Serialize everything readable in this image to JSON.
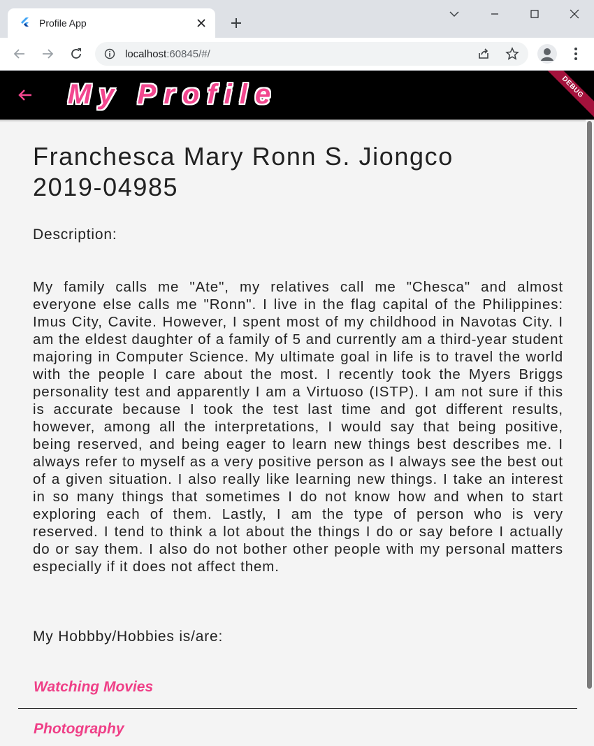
{
  "browser": {
    "tab_title": "Profile App",
    "url_host": "localhost",
    "url_rest": ":60845/#/",
    "icons": [
      "flutter-favicon-icon",
      "close-icon",
      "plus-icon",
      "chevron-down-icon",
      "minimize-icon",
      "maximize-icon",
      "close-window-icon",
      "back-icon",
      "forward-icon",
      "reload-icon",
      "info-icon",
      "share-icon",
      "star-icon",
      "profile-icon",
      "kebab-menu-icon"
    ]
  },
  "app": {
    "title": "My Profile",
    "debug_label": "DEBUG",
    "accent_color": "#f2468e"
  },
  "profile": {
    "name": "Franchesca Mary Ronn S. Jiongco",
    "student_number": "2019-04985",
    "description_label": "Description:",
    "description": "My family calls me \"Ate\", my relatives call me \"Chesca\" and almost everyone else calls me \"Ronn\". I live in the flag capital of the Philippines: Imus City, Cavite. However, I spent most of my childhood in Navotas City. I am the eldest daughter of a family of 5 and currently am a third-year student majoring in Computer Science. My ultimate goal in life is to travel the world with the people I care about the most. I recently took the Myers Briggs personality test and apparently I am a Virtuoso (ISTP). I am not sure if this is accurate because I took the test last time and got different results, however, among all the interpretations, I would say that being positive, being reserved, and being eager to learn new things best describes me. I always refer to myself as a very positive person as I always see the best out of a given situation. I also really like learning new things. I take an interest in so many things that sometimes I do not know how and when to start exploring each of them. Lastly, I am the type of person who is very reserved. I tend to think a lot about the things I do or say before I actually do or say them. I also do not bother other people with my personal matters especially if it does not affect them.",
    "hobbies_label": "My Hobbby/Hobbies is/are:",
    "hobbies": [
      "Watching Movies",
      "Photography"
    ]
  }
}
